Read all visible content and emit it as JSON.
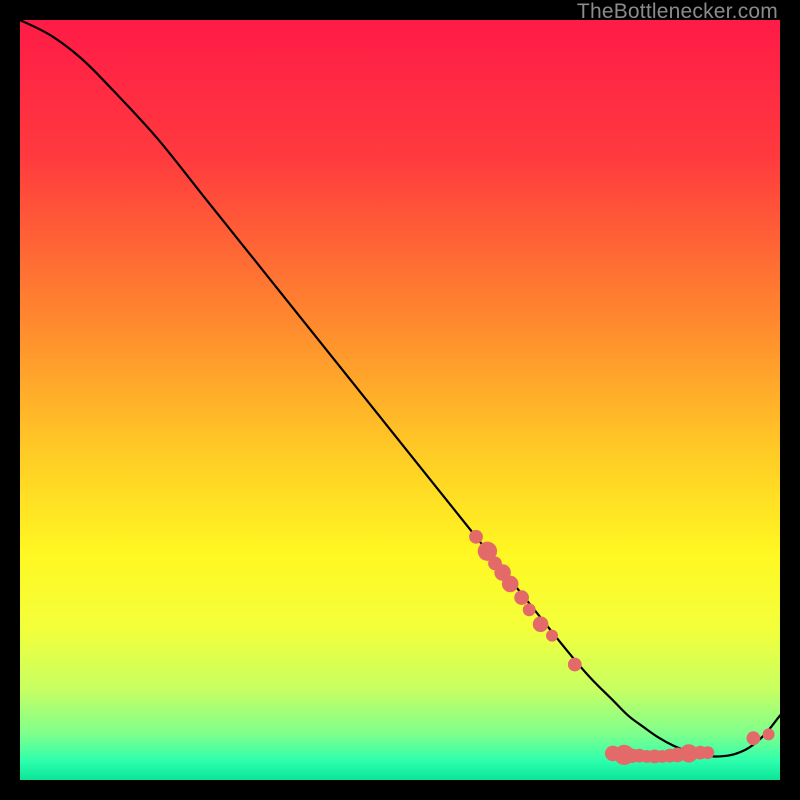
{
  "watermark": "TheBottlenecker.com",
  "gradient": {
    "stops": [
      {
        "offset": 0.0,
        "color": "#ff1b47"
      },
      {
        "offset": 0.18,
        "color": "#ff3a3e"
      },
      {
        "offset": 0.4,
        "color": "#ff8a2e"
      },
      {
        "offset": 0.58,
        "color": "#ffcf25"
      },
      {
        "offset": 0.7,
        "color": "#fff722"
      },
      {
        "offset": 0.8,
        "color": "#f3ff3a"
      },
      {
        "offset": 0.88,
        "color": "#c8ff62"
      },
      {
        "offset": 0.94,
        "color": "#7dff8d"
      },
      {
        "offset": 0.975,
        "color": "#2dffad"
      },
      {
        "offset": 1.0,
        "color": "#0be59a"
      }
    ]
  },
  "chart_data": {
    "type": "line",
    "title": "",
    "xlabel": "",
    "ylabel": "",
    "xlim": [
      0,
      100
    ],
    "ylim": [
      0,
      100
    ],
    "series": [
      {
        "name": "curve",
        "x": [
          0,
          4,
          8,
          12,
          18,
          24,
          30,
          36,
          42,
          48,
          54,
          60,
          64,
          68,
          72,
          75,
          78,
          80,
          82,
          84,
          86,
          88,
          90,
          92,
          94,
          96,
          98,
          100
        ],
        "y": [
          100,
          98,
          95,
          91,
          84.5,
          77,
          69.5,
          62,
          54.5,
          47,
          39.5,
          32,
          27,
          22,
          17,
          13.5,
          10.5,
          8.5,
          7,
          5.6,
          4.5,
          3.7,
          3.2,
          3.1,
          3.4,
          4.3,
          6.0,
          8.5
        ]
      }
    ],
    "markers": {
      "name": "dots",
      "color": "#e46a6a",
      "points": [
        {
          "x": 60.0,
          "y": 32.0,
          "r": 3.0
        },
        {
          "x": 61.5,
          "y": 30.1,
          "r": 4.2
        },
        {
          "x": 62.5,
          "y": 28.5,
          "r": 3.0
        },
        {
          "x": 63.5,
          "y": 27.3,
          "r": 3.6
        },
        {
          "x": 64.5,
          "y": 25.8,
          "r": 3.6
        },
        {
          "x": 66.0,
          "y": 24.0,
          "r": 3.2
        },
        {
          "x": 67.0,
          "y": 22.4,
          "r": 2.8
        },
        {
          "x": 68.5,
          "y": 20.5,
          "r": 3.4
        },
        {
          "x": 70.0,
          "y": 19.0,
          "r": 2.6
        },
        {
          "x": 73.0,
          "y": 15.2,
          "r": 3.0
        },
        {
          "x": 78.0,
          "y": 3.5,
          "r": 3.4
        },
        {
          "x": 79.5,
          "y": 3.3,
          "r": 4.4
        },
        {
          "x": 80.5,
          "y": 3.2,
          "r": 3.2
        },
        {
          "x": 81.5,
          "y": 3.2,
          "r": 3.0
        },
        {
          "x": 82.5,
          "y": 3.1,
          "r": 2.8
        },
        {
          "x": 83.5,
          "y": 3.1,
          "r": 3.0
        },
        {
          "x": 84.5,
          "y": 3.1,
          "r": 2.8
        },
        {
          "x": 85.5,
          "y": 3.2,
          "r": 3.0
        },
        {
          "x": 86.5,
          "y": 3.3,
          "r": 3.2
        },
        {
          "x": 88.0,
          "y": 3.5,
          "r": 4.0
        },
        {
          "x": 89.5,
          "y": 3.6,
          "r": 3.0
        },
        {
          "x": 90.5,
          "y": 3.6,
          "r": 2.8
        },
        {
          "x": 96.5,
          "y": 5.5,
          "r": 3.0
        },
        {
          "x": 98.5,
          "y": 6.0,
          "r": 2.6
        }
      ]
    }
  }
}
